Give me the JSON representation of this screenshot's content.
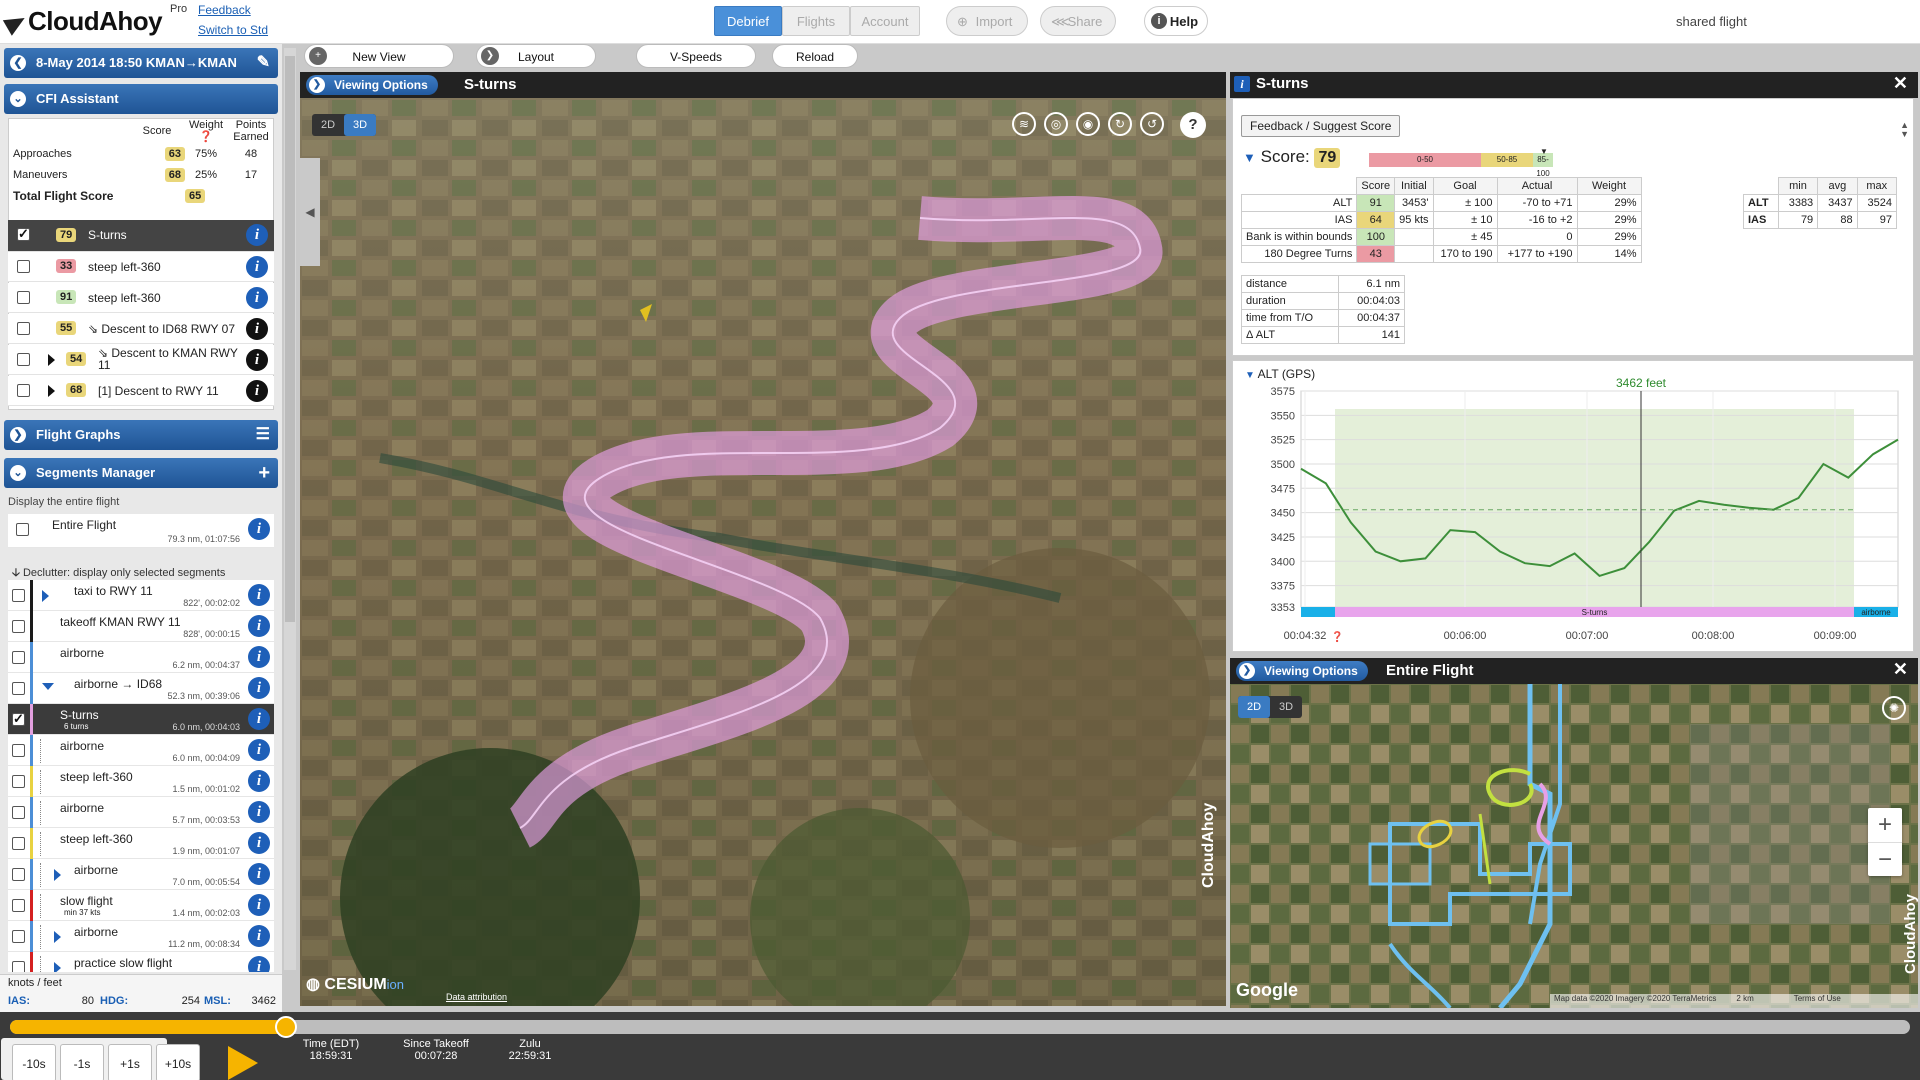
{
  "app": {
    "logo": "CloudAhoy",
    "tier": "Pro",
    "feedback": "Feedback",
    "switch": "Switch to Std"
  },
  "nav": {
    "debrief": "Debrief",
    "flights": "Flights",
    "account": "Account",
    "import": "Import",
    "share": "Share",
    "help": "Help",
    "shared": "shared flight"
  },
  "flight": {
    "title": "8-May 2014 18:50  KMAN→KMAN"
  },
  "cfi": {
    "header": "CFI Assistant",
    "col_score": "Score",
    "col_weight": "Weight",
    "col_points": "Points Earned",
    "rows": [
      {
        "label": "Approaches",
        "score": "63",
        "weight": "75%",
        "points": "48"
      },
      {
        "label": "Maneuvers",
        "score": "68",
        "weight": "25%",
        "points": "17"
      }
    ],
    "total_label": "Total Flight Score",
    "total": "65",
    "items": [
      {
        "score": "79",
        "label": "S-turns"
      },
      {
        "score": "33",
        "label": "steep left-360"
      },
      {
        "score": "91",
        "label": "steep left-360"
      },
      {
        "score": "55",
        "label": "⇘ Descent to ID68 RWY 07"
      },
      {
        "score": "54",
        "label": "⇘ Descent to KMAN RWY 11"
      },
      {
        "score": "68",
        "label": "[1] Descent to RWY 11"
      }
    ]
  },
  "flight_graphs": "Flight Graphs",
  "segments": {
    "header": "Segments Manager",
    "display_all": "Display the entire flight",
    "entire": {
      "name": "Entire Flight",
      "sub": "79.3 nm, 01:07:56"
    },
    "declutter": "Declutter: display only selected segments",
    "items": [
      {
        "name": "taxi to RWY 11",
        "sub": "822', 00:02:02",
        "color": "#1a1a1a"
      },
      {
        "name": "takeoff KMAN RWY 11",
        "sub": "828', 00:00:15",
        "color": "#1a1a1a"
      },
      {
        "name": "airborne",
        "sub": "6.2 nm, 00:04:37",
        "color": "#4c8ed6"
      },
      {
        "name": "airborne → ID68",
        "sub": "52.3 nm, 00:39:06",
        "color": "#4c8ed6"
      },
      {
        "name": "S-turns",
        "sub": "6.0 nm, 00:04:03",
        "extra": "6 turns",
        "color": "#e3a0e0"
      },
      {
        "name": "airborne",
        "sub": "6.0 nm, 00:04:09",
        "color": "#4c8ed6"
      },
      {
        "name": "steep left-360",
        "sub": "1.5 nm, 00:01:02",
        "color": "#e8d240"
      },
      {
        "name": "airborne",
        "sub": "5.7 nm, 00:03:53",
        "color": "#4c8ed6"
      },
      {
        "name": "steep left-360",
        "sub": "1.9 nm, 00:01:07",
        "color": "#e8d240"
      },
      {
        "name": "airborne",
        "sub": "7.0 nm, 00:05:54",
        "color": "#4c8ed6"
      },
      {
        "name": "slow flight",
        "sub": "1.4 nm, 00:02:03",
        "extra": "min 37 kts",
        "color": "#d42020"
      },
      {
        "name": "airborne",
        "sub": "11.2 nm, 00:08:34",
        "color": "#4c8ed6"
      },
      {
        "name": "practice slow flight",
        "sub": "",
        "color": "#d42020"
      }
    ]
  },
  "readout": {
    "units": "knots / feet",
    "ias_label": "IAS:",
    "ias": "80",
    "hdg_label": "HDG:",
    "hdg": "254",
    "msl_label": "MSL:",
    "msl": "3462"
  },
  "toolbar": {
    "new_view": "New View",
    "layout": "Layout",
    "vspeeds": "V-Speeds",
    "reload": "Reload"
  },
  "view3d": {
    "opts": "Viewing Options",
    "title": "S-turns",
    "t2d": "2D",
    "t3d": "3D",
    "cesium": "CESIUM",
    "ion": "ion",
    "attr": "Data attribution",
    "brand": "CloudAhoy"
  },
  "detail": {
    "title": "S-turns",
    "feedback": "Feedback / Suggest Score",
    "score_label": "Score:",
    "score": "79",
    "bands": [
      "0-50",
      "50-85",
      "85-100"
    ],
    "headers": [
      "Score",
      "Initial",
      "Goal",
      "Actual",
      "Weight"
    ],
    "rows": [
      {
        "name": "ALT",
        "score": "91",
        "initial": "3453'",
        "goal": "± 100",
        "actual": "-70 to +71",
        "weight": "29%"
      },
      {
        "name": "IAS",
        "score": "64",
        "initial": "95 kts",
        "goal": "± 10",
        "actual": "-16 to +2",
        "weight": "29%"
      },
      {
        "name": "Bank is within bounds",
        "score": "100",
        "initial": "",
        "goal": "± 45",
        "actual": "0",
        "weight": "29%"
      },
      {
        "name": "180 Degree Turns",
        "score": "43",
        "initial": "",
        "goal": "170 to 190",
        "actual": "+177 to +190",
        "weight": "14%"
      }
    ],
    "mma_headers": [
      "min",
      "avg",
      "max"
    ],
    "mma": [
      {
        "name": "ALT",
        "min": "3383",
        "avg": "3437",
        "max": "3524"
      },
      {
        "name": "IAS",
        "min": "79",
        "avg": "88",
        "max": "97"
      }
    ],
    "facts": [
      {
        "k": "distance",
        "v": "6.1 nm"
      },
      {
        "k": "duration",
        "v": "00:04:03"
      },
      {
        "k": "time from T/O",
        "v": "00:04:37"
      },
      {
        "k": "Δ ALT",
        "v": "141"
      }
    ]
  },
  "chart_data": {
    "type": "line",
    "title": "ALT (GPS)",
    "annotation": "3462 feet",
    "ylim": [
      3353,
      3575
    ],
    "yticks": [
      "3575",
      "3550",
      "3525",
      "3500",
      "3475",
      "3450",
      "3425",
      "3400",
      "3375",
      "3353"
    ],
    "xticks": [
      "00:04:32",
      "00:06:00",
      "00:07:00",
      "00:08:00",
      "00:09:00"
    ],
    "series": [
      {
        "values": [
          3495,
          3480,
          3440,
          3410,
          3400,
          3403,
          3432,
          3430,
          3410,
          3398,
          3395,
          3408,
          3385,
          3393,
          3420,
          3452,
          3462,
          3458,
          3455,
          3453,
          3465,
          3500,
          3486,
          3510,
          3525
        ]
      }
    ],
    "segments": [
      "S-turns",
      "airborne"
    ]
  },
  "map": {
    "opts": "Viewing Options",
    "title": "Entire Flight",
    "t2d": "2D",
    "t3d": "3D",
    "google": "Google",
    "attr": "Map data ©2020 Imagery ©2020 TerraMetrics",
    "scale": "2 km",
    "terms": "Terms of Use",
    "plus": "+",
    "minus": "−",
    "brand": "CloudAhoy"
  },
  "bottom": {
    "m10": "-10s",
    "m1": "-1s",
    "p1": "+1s",
    "p10": "+10s",
    "time_label": "Time (EDT)",
    "time": "18:59:31",
    "since_label": "Since Takeoff",
    "since": "00:07:28",
    "zulu_label": "Zulu",
    "zulu": "22:59:31",
    "progress": 0.145
  }
}
